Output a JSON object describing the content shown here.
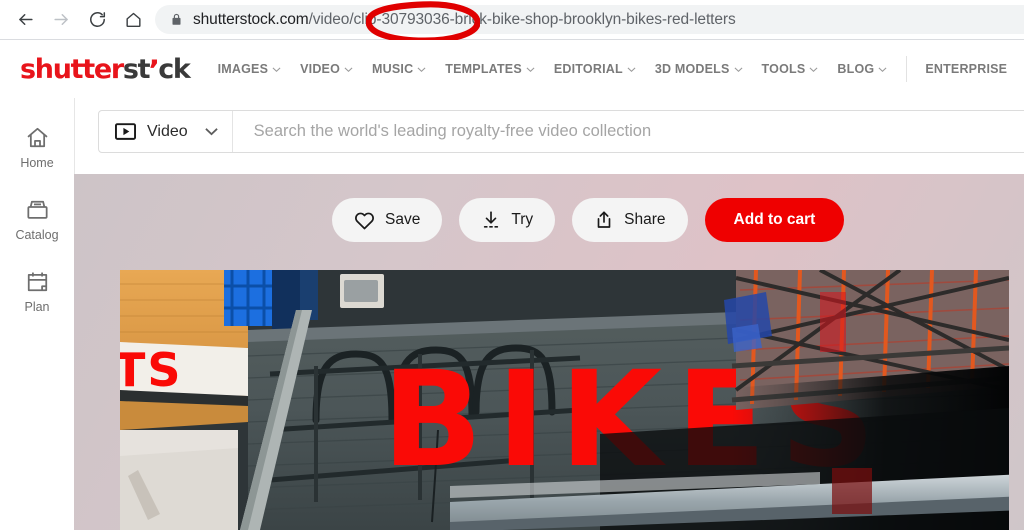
{
  "browser": {
    "back_icon": "arrow-left-icon",
    "forward_icon": "arrow-right-icon",
    "reload_icon": "reload-icon",
    "home_icon": "home-icon",
    "lock_icon": "lock-icon",
    "url_host": "shutterstock.com",
    "url_path": "/video/clip-30793036-brick-bike-shop-brooklyn-bikes-red-letters",
    "url_full": "shutterstock.com/video/clip-30793036-brick-bike-shop-brooklyn-bikes-red-letters",
    "annotation": {
      "type": "hand-drawn-ellipse",
      "color": "#e00000",
      "encircles": "-30793036-"
    }
  },
  "header": {
    "logo": {
      "part1": "shutter",
      "part2": "st",
      "comma": "’",
      "part3": "ck",
      "red": "#e8141b",
      "dark": "#3a3a3a"
    },
    "nav": [
      {
        "label": "IMAGES",
        "caret": true
      },
      {
        "label": "VIDEO",
        "caret": true
      },
      {
        "label": "MUSIC",
        "caret": true
      },
      {
        "label": "TEMPLATES",
        "caret": true
      },
      {
        "label": "EDITORIAL",
        "caret": true
      },
      {
        "label": "3D MODELS",
        "caret": true
      },
      {
        "label": "TOOLS",
        "caret": true
      },
      {
        "label": "BLOG",
        "caret": true
      }
    ],
    "enterprise_label": "ENTERPRISE"
  },
  "search": {
    "type_label": "Video",
    "type_icon": "video-play-icon",
    "caret_icon": "chevron-down-icon",
    "placeholder": "Search the world's leading royalty-free video collection",
    "value": ""
  },
  "sidebar": {
    "items": [
      {
        "label": "Home",
        "icon": "house-icon"
      },
      {
        "label": "Catalog",
        "icon": "archive-tray-icon"
      },
      {
        "label": "Plan",
        "icon": "calendar-icon"
      }
    ]
  },
  "actions": {
    "save": {
      "label": "Save",
      "icon": "heart-icon"
    },
    "try": {
      "label": "Try",
      "icon": "download-icon"
    },
    "share": {
      "label": "Share",
      "icon": "share-upload-icon"
    },
    "cart": {
      "label": "Add to cart",
      "icon": "",
      "color": "#ef0000"
    }
  },
  "media": {
    "sign_text": "BIKES",
    "sign_color": "#fa0a06",
    "left_sign_text": "TS",
    "background_gradient": [
      "#cdc4c7",
      "#dec2c7"
    ],
    "description": "brick bike shop brooklyn bikes red letters"
  }
}
